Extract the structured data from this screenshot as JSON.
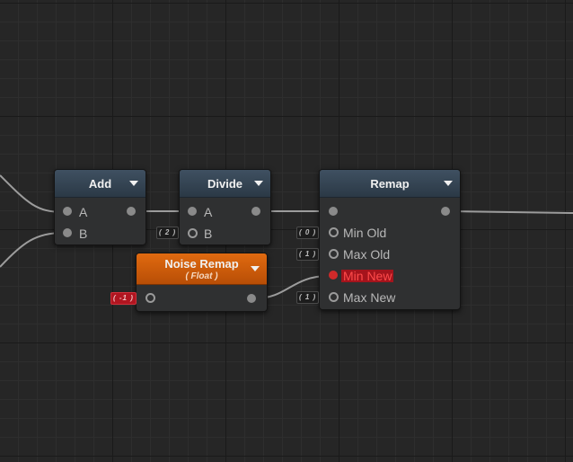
{
  "nodes": {
    "add": {
      "title": "Add",
      "inputs": [
        "A",
        "B"
      ]
    },
    "divide": {
      "title": "Divide",
      "inputs": [
        "A",
        "B"
      ],
      "default_b": "( 2 )"
    },
    "remap": {
      "title": "Remap",
      "inputs": [
        "Min Old",
        "Max Old",
        "Min New",
        "Max New"
      ],
      "defaults": [
        "( 0 )",
        "( 1 )",
        "( 1 )"
      ]
    },
    "noise_remap": {
      "title": "Noise Remap",
      "subtitle": "( Float )",
      "default_in": "( -1 )"
    }
  },
  "colors": {
    "header_blue": "#34455a",
    "header_orange": "#d2600a",
    "highlight_red": "#a5141c",
    "wire": "#9c9c9c"
  }
}
